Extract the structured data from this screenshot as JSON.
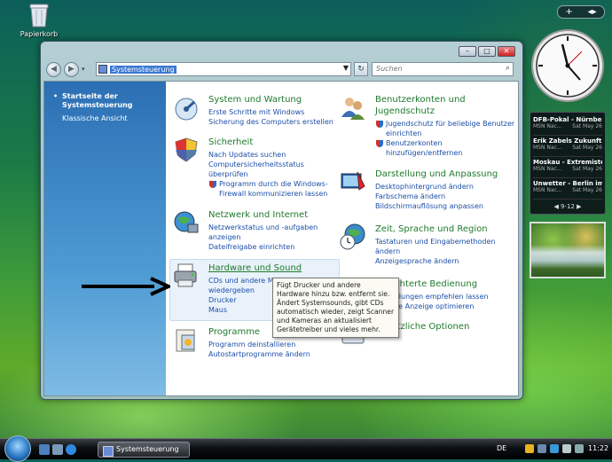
{
  "desktop": {
    "recycle_bin_label": "Papierkorb"
  },
  "window": {
    "address": "Systemsteuerung",
    "search_placeholder": "Suchen",
    "buttons": {
      "minimize": "–",
      "maximize": "□",
      "close": "✕"
    }
  },
  "sidebar": {
    "items": [
      {
        "label": "Startseite der Systemsteuerung",
        "active": true
      },
      {
        "label": "Klassische Ansicht",
        "active": false
      }
    ]
  },
  "categories": [
    {
      "title": "System und Wartung",
      "icon": "system-maintenance-icon",
      "links": [
        "Erste Schritte mit Windows",
        "Sicherung des Computers erstellen"
      ]
    },
    {
      "title": "Sicherheit",
      "icon": "security-shield-icon",
      "links": [
        "Nach Updates suchen",
        "Computersicherheitsstatus überprüfen",
        "Programm durch die Windows-Firewall kommunizieren lassen"
      ]
    },
    {
      "title": "Netzwerk und Internet",
      "icon": "network-globe-icon",
      "links": [
        "Netzwerkstatus und -aufgaben anzeigen",
        "Dateifreigabe einrichten"
      ]
    },
    {
      "title": "Hardware und Sound",
      "icon": "printer-hardware-icon",
      "links": [
        "CDs und andere Medien automatisch wiedergeben",
        "Drucker",
        "Maus"
      ]
    },
    {
      "title": "Programme",
      "icon": "programs-icon",
      "links": [
        "Programm deinstallieren",
        "Autostartprogramme ändern"
      ]
    },
    {
      "title": "Benutzerkonten und Jugendschutz",
      "icon": "user-accounts-icon",
      "links": [
        "Jugendschutz für beliebige Benutzer einrichten",
        "Benutzerkonten hinzufügen/entfernen"
      ]
    },
    {
      "title": "Darstellung und Anpassung",
      "icon": "appearance-icon",
      "links": [
        "Desktophintergrund ändern",
        "Farbschema ändern",
        "Bildschirmauflösung anpassen"
      ]
    },
    {
      "title": "Zeit, Sprache und Region",
      "icon": "clock-globe-icon",
      "links": [
        "Tastaturen und Eingabemethoden ändern",
        "Anzeigesprache ändern"
      ]
    },
    {
      "title": "Erleichterte Bedienung",
      "icon": "ease-of-access-icon",
      "links": [
        "Einstellungen empfehlen lassen",
        "Visuelle Anzeige optimieren"
      ]
    },
    {
      "title": "Zusätzliche Optionen",
      "icon": "additional-options-icon",
      "links": []
    }
  ],
  "tooltip": "Fügt Drucker und andere Hardware hinzu bzw. entfernt sie. Ändert Systemsounds, gibt CDs automatisch wieder, zeigt Scanner und Kameras an aktualisiert Gerätetreiber und vieles mehr.",
  "news": {
    "items": [
      {
        "headline": "DFB-Pokal - Nürnber...",
        "source": "MSN Nac...",
        "date": "Sat May 26"
      },
      {
        "headline": "Erik Zabels Zukunft -...",
        "source": "MSN Nac...",
        "date": "Sat May 26"
      },
      {
        "headline": "Moskau - Extremiste...",
        "source": "MSN Nac...",
        "date": "Sat May 26"
      },
      {
        "headline": "Unwetter - Berlin im...",
        "source": "MSN Nac...",
        "date": "Sat May 26"
      }
    ],
    "pager": "9-12"
  },
  "taskbar": {
    "task_label": "Systemsteuerung",
    "language": "DE",
    "time": "11:22"
  },
  "colors": {
    "category_title": "#1f7a2c",
    "link": "#1b4fa8",
    "sidebar": "#2c6fb4"
  }
}
